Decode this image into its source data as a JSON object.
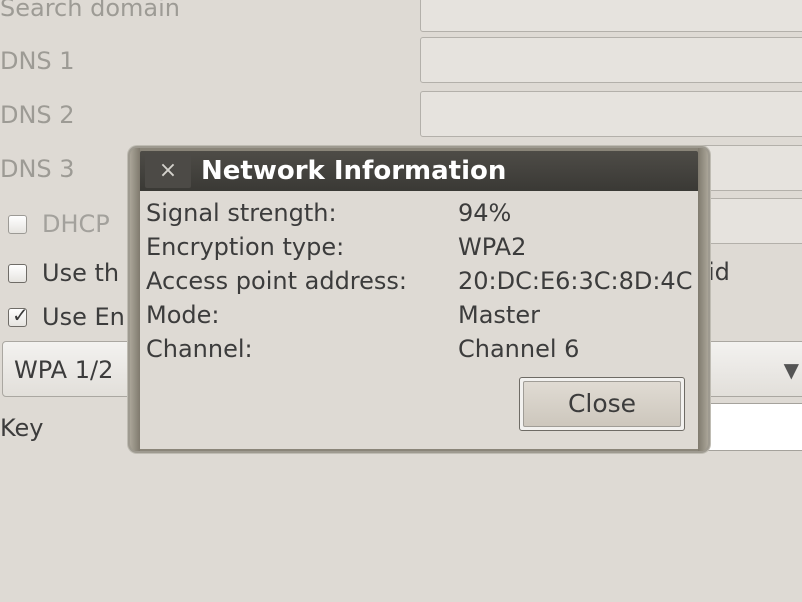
{
  "form": {
    "search_domain_label": "Search domain",
    "dns1_label": "DNS 1",
    "dns2_label": "DNS 2",
    "dns3_label": "DNS 3",
    "dhcp_label": "DHCP",
    "use_hidden_label": "Use th",
    "ssid_tail": "id",
    "use_encryption_label": "Use En",
    "encryption_select_value": "WPA 1/2",
    "key_label": "Key"
  },
  "dialog": {
    "title": "Network Information",
    "close_icon": "×",
    "rows": [
      {
        "label": "Signal strength:",
        "value": "94%"
      },
      {
        "label": "Encryption type:",
        "value": "WPA2"
      },
      {
        "label": "Access point address:",
        "value": "20:DC:E6:3C:8D:4C"
      },
      {
        "label": "Mode:",
        "value": "Master"
      },
      {
        "label": "Channel:",
        "value": "Channel 6"
      }
    ],
    "close_button_label": "Close"
  },
  "colors": {
    "window_bg": "#dedad4",
    "titlebar": "#3c3b37",
    "title_text": "#ffffff"
  }
}
